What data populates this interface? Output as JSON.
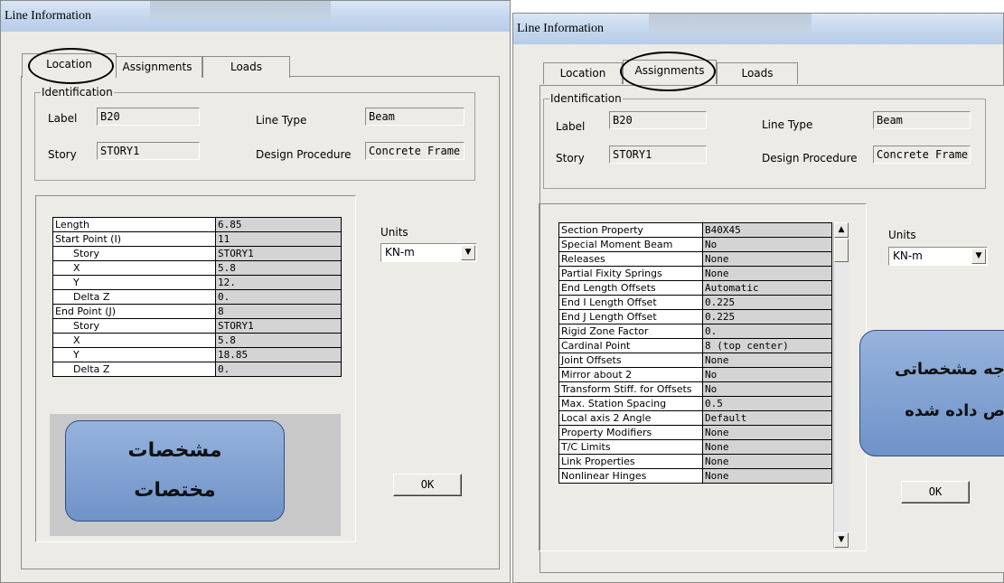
{
  "left_dialog": {
    "title": "Line Information",
    "tabs": [
      {
        "label": "Location",
        "active": true
      },
      {
        "label": "Assignments",
        "active": false
      },
      {
        "label": "Loads",
        "active": false
      }
    ],
    "identification": {
      "legend": "Identification",
      "label_caption": "Label",
      "label_value": "B20",
      "story_caption": "Story",
      "story_value": "STORY1",
      "line_type_caption": "Line Type",
      "line_type_value": "Beam",
      "design_proc_caption": "Design Procedure",
      "design_proc_value": "Concrete Frame"
    },
    "table": [
      {
        "name": "Length",
        "value": "6.85",
        "indent": false
      },
      {
        "name": "Start Point (I)",
        "value": "11",
        "indent": false
      },
      {
        "name": "Story",
        "value": "STORY1",
        "indent": true
      },
      {
        "name": "X",
        "value": "5.8",
        "indent": true
      },
      {
        "name": "Y",
        "value": "12.",
        "indent": true
      },
      {
        "name": "Delta Z",
        "value": "0.",
        "indent": true
      },
      {
        "name": "End Point (J)",
        "value": "8",
        "indent": false
      },
      {
        "name": "Story",
        "value": "STORY1",
        "indent": true
      },
      {
        "name": "X",
        "value": "5.8",
        "indent": true
      },
      {
        "name": "Y",
        "value": "18.85",
        "indent": true
      },
      {
        "name": "Delta Z",
        "value": "0.",
        "indent": true
      }
    ],
    "units_caption": "Units",
    "units_value": "KN-m",
    "ok_label": "OK",
    "callout_line1": "مشخصات",
    "callout_line2": "مختصات"
  },
  "right_dialog": {
    "title": "Line Information",
    "tabs": [
      {
        "label": "Location",
        "active": false
      },
      {
        "label": "Assignments",
        "active": true
      },
      {
        "label": "Loads",
        "active": false
      }
    ],
    "identification": {
      "legend": "Identification",
      "label_caption": "Label",
      "label_value": "B20",
      "story_caption": "Story",
      "story_value": "STORY1",
      "line_type_caption": "Line Type",
      "line_type_value": "Beam",
      "design_proc_caption": "Design Procedure",
      "design_proc_value": "Concrete Frame"
    },
    "table": [
      {
        "name": "Section Property",
        "value": "B40X45"
      },
      {
        "name": "Special Moment Beam",
        "value": "No"
      },
      {
        "name": "Releases",
        "value": "None"
      },
      {
        "name": "Partial Fixity Springs",
        "value": "None"
      },
      {
        "name": "End Length Offsets",
        "value": "Automatic"
      },
      {
        "name": "End I Length Offset",
        "value": "0.225"
      },
      {
        "name": "End J Length Offset",
        "value": "0.225"
      },
      {
        "name": "Rigid Zone Factor",
        "value": "0."
      },
      {
        "name": "Cardinal Point",
        "value": "8 (top center)"
      },
      {
        "name": "Joint Offsets",
        "value": "None"
      },
      {
        "name": "Mirror about 2",
        "value": "No"
      },
      {
        "name": "Transform Stiff. for Offsets",
        "value": "No"
      },
      {
        "name": "Max. Station Spacing",
        "value": "0.5"
      },
      {
        "name": "Local axis 2 Angle",
        "value": "Default"
      },
      {
        "name": "Property Modifiers",
        "value": "None"
      },
      {
        "name": "T/C Limits",
        "value": "None"
      },
      {
        "name": "Link Properties",
        "value": "None"
      },
      {
        "name": "Nonlinear Hinges",
        "value": "None"
      }
    ],
    "units_caption": "Units",
    "units_value": "KN-m",
    "ok_label": "OK",
    "callout_line1": "جه مشخصاتی",
    "callout_line2": "ص داده شده"
  },
  "icons": {
    "dropdown": "chevron-down-icon",
    "scroll_up": "arrow-up-icon",
    "scroll_down": "arrow-down-icon"
  }
}
